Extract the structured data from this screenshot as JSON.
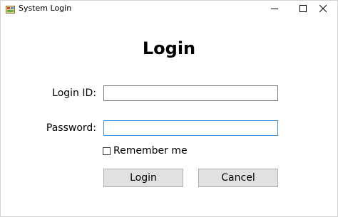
{
  "window": {
    "title": "System Login",
    "app_icon": "winforms-app-icon",
    "controls": {
      "minimize_icon": "minimize-icon",
      "maximize_icon": "maximize-icon",
      "close_icon": "close-icon"
    }
  },
  "form": {
    "heading": "Login",
    "login_id": {
      "label": "Login ID:",
      "value": ""
    },
    "password": {
      "label": "Password:",
      "value": ""
    },
    "remember": {
      "label": "Remember me",
      "checked": false
    },
    "buttons": {
      "login": "Login",
      "cancel": "Cancel"
    }
  },
  "colors": {
    "focus_border": "#3d8fd6",
    "button_face": "#e1e1e1"
  }
}
